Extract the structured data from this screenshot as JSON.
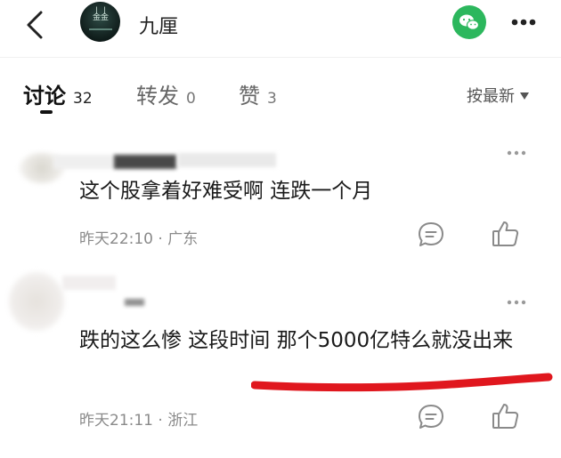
{
  "header": {
    "title": "九厘",
    "back_icon": "chevron-left-icon",
    "share_icon": "wechat-icon",
    "more_icon": "more-horizontal-icon",
    "share_color": "#2cb75d"
  },
  "tabs": [
    {
      "label": "讨论",
      "count": "32",
      "active": true
    },
    {
      "label": "转发",
      "count": "0",
      "active": false
    },
    {
      "label": "赞",
      "count": "3",
      "active": false
    }
  ],
  "sort": {
    "label": "按最新"
  },
  "comments": [
    {
      "text": "这个股拿着好难受啊 连跌一个月",
      "time": "昨天22:10",
      "location": "广东"
    },
    {
      "text": "跌的这么惨 这段时间 那个5000亿特么就没出来",
      "time": "昨天21:11",
      "location": "浙江"
    }
  ],
  "colors": {
    "accent": "#2cb75d",
    "highlight_stroke": "#e0171e",
    "meta_text": "#8a8a8a"
  }
}
